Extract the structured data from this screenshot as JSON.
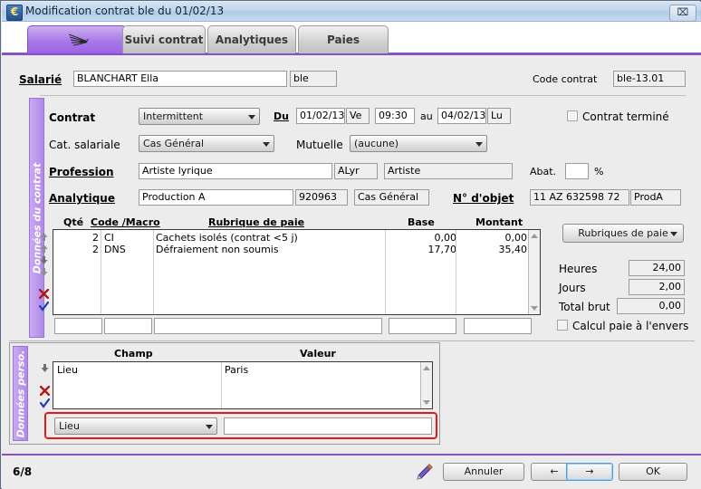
{
  "window": {
    "title": "Modification contrat ble du 01/02/13",
    "icon": "euro-app-icon",
    "close_label": "⌧"
  },
  "tabs": [
    {
      "label": "",
      "icon": "dragonfly-icon",
      "active": true,
      "name": "tab-general"
    },
    {
      "label": "Suivi contrat",
      "active": false,
      "name": "tab-suivi-contrat"
    },
    {
      "label": "Analytiques",
      "active": false,
      "name": "tab-analytiques"
    },
    {
      "label": "Paies",
      "active": false,
      "name": "tab-paies"
    }
  ],
  "header": {
    "salarie_label": "Salarié",
    "salarie_value": "BLANCHART Ella",
    "salarie_code": "ble",
    "code_contrat_label": "Code contrat",
    "code_contrat_value": "ble-13.01"
  },
  "contract_section": {
    "side_label": "Données du contrat",
    "contrat_label": "Contrat",
    "contrat_value": "Intermittent",
    "du_label": "Du",
    "du_date": "01/02/13",
    "du_day": "Ve",
    "du_time": "09:30",
    "au_label": "au",
    "au_date": "04/02/13",
    "au_day": "Lu",
    "contrat_termine_label": "Contrat terminé",
    "contrat_termine_checked": false,
    "cat_salariale_label": "Cat. salariale",
    "cat_salariale_value": "Cas Général",
    "mutuelle_label": "Mutuelle",
    "mutuelle_value": "(aucune)",
    "profession_label": "Profession",
    "profession_value": "Artiste lyrique",
    "profession_code": "ALyr",
    "profession_categorie": "Artiste",
    "abat_label": "Abat.",
    "abat_value": "",
    "percent_label": "%",
    "analytique_label": "Analytique",
    "analytique_value": "Production A",
    "analytique_code": "920963",
    "analytique_cas": "Cas Général",
    "num_objet_label": "N° d'objet",
    "num_objet_value": "11 AZ 632598 72",
    "num_objet_code": "ProdA"
  },
  "paie_grid": {
    "columns": [
      "Qté",
      "Code /Macro",
      "Rubrique de paie",
      "Base",
      "Montant"
    ],
    "rows": [
      {
        "qte": "2",
        "code": "CI",
        "rubrique": "Cachets isolés (contrat <5 j)",
        "base": "0,00",
        "montant": "0,00"
      },
      {
        "qte": "2",
        "code": "DNS",
        "rubrique": "Défraiement non soumis",
        "base": "17,70",
        "montant": "35,40"
      }
    ],
    "entry_row": {
      "qte": "",
      "code": "",
      "rubrique": "",
      "base": "",
      "montant": ""
    }
  },
  "totals": {
    "rubriques_button": "Rubriques de paie",
    "heures_label": "Heures",
    "heures_value": "24,00",
    "jours_label": "Jours",
    "jours_value": "2,00",
    "total_brut_label": "Total brut",
    "total_brut_value": "0,00",
    "calcul_envers_label": "Calcul paie à l'envers",
    "calcul_envers_checked": false
  },
  "perso_section": {
    "side_label": "Données perso.",
    "columns": [
      "Champ",
      "Valeur"
    ],
    "rows": [
      {
        "champ": "Lieu",
        "valeur": "Paris"
      }
    ],
    "entry_champ": "Lieu",
    "entry_valeur": "",
    "entry_valeur_placeholder": "",
    "highlight_color": "#e01b1b"
  },
  "footer": {
    "page_indicator": "6/8",
    "pen_icon": "pen-icon",
    "cancel_label": "Annuler",
    "prev_label": "←",
    "next_label": "→",
    "ok_label": "OK"
  },
  "icons": {
    "move_up_top": "arrow-up-top-icon",
    "move_up": "arrow-up-icon",
    "move_down": "arrow-down-icon",
    "move_down_bottom": "arrow-down-bottom-icon",
    "delete": "red-cross-icon",
    "validate": "blue-check-icon"
  }
}
